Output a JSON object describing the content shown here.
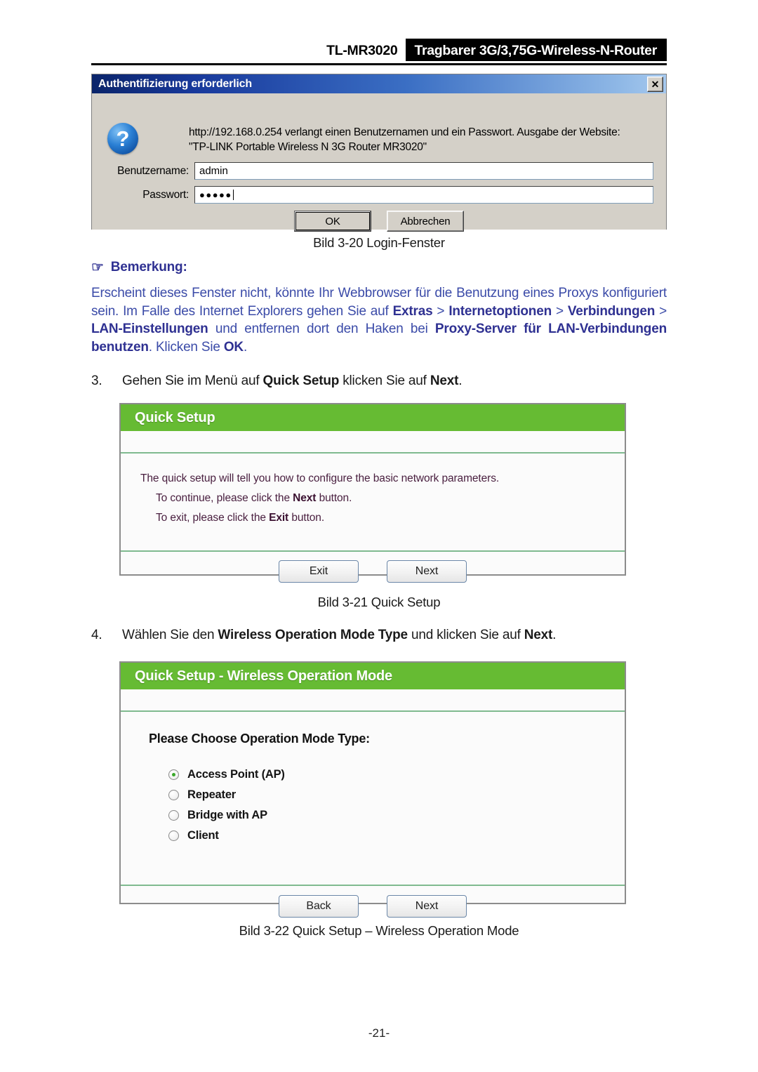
{
  "header": {
    "model": "TL-MR3020",
    "product": "Tragbarer 3G/3,75G-Wireless-N-Router"
  },
  "auth_dialog": {
    "title": "Authentifizierung erforderlich",
    "close_label": "✕",
    "icon": "question-icon",
    "icon_glyph": "?",
    "message_line1": "http://192.168.0.254 verlangt einen Benutzernamen und ein Passwort. Ausgabe der Website:",
    "message_line2": "\"TP-LINK Portable Wireless N 3G Router MR3020\"",
    "username_label": "Benutzername:",
    "username_value": "admin",
    "password_label": "Passwort:",
    "password_value": "●●●●●",
    "ok_label": "OK",
    "cancel_label": "Abbrechen"
  },
  "caption_320": "Bild 3-20 Login-Fenster",
  "note": {
    "hand_glyph": "☞",
    "heading": "Bemerkung:",
    "parts": [
      {
        "text": "Erscheint dieses Fenster nicht, könnte Ihr Webbrowser für die Benutzung eines Proxys konfiguriert sein. Im Falle des Internet Explorers gehen Sie auf ",
        "bold": false
      },
      {
        "text": "Extras",
        "bold": true
      },
      {
        "text": " > ",
        "bold": false
      },
      {
        "text": "Internetoptionen",
        "bold": true
      },
      {
        "text": " > ",
        "bold": false
      },
      {
        "text": "Verbindungen",
        "bold": true
      },
      {
        "text": " > ",
        "bold": false
      },
      {
        "text": "LAN-Einstellungen",
        "bold": true
      },
      {
        "text": " und entfernen dort den Haken bei ",
        "bold": false
      },
      {
        "text": "Proxy-Server für LAN-Verbindungen benutzen",
        "bold": true
      },
      {
        "text": ". Klicken Sie ",
        "bold": false
      },
      {
        "text": "OK",
        "bold": true
      },
      {
        "text": ".",
        "bold": false
      }
    ]
  },
  "step3": {
    "number": "3.",
    "parts": [
      {
        "text": "Gehen Sie im Menü auf ",
        "bold": false
      },
      {
        "text": "Quick Setup",
        "bold": true
      },
      {
        "text": " klicken Sie auf ",
        "bold": false
      },
      {
        "text": "Next",
        "bold": true
      },
      {
        "text": ".",
        "bold": false
      }
    ]
  },
  "quick_setup_panel": {
    "header": "Quick Setup",
    "lines": [
      {
        "parts": [
          {
            "text": "The quick setup will tell you how to configure the basic network parameters.",
            "bold": false
          }
        ],
        "indent": false
      },
      {
        "parts": [
          {
            "text": "To continue, please click the ",
            "bold": false
          },
          {
            "text": "Next",
            "bold": true
          },
          {
            "text": " button.",
            "bold": false
          }
        ],
        "indent": true
      },
      {
        "parts": [
          {
            "text": "To exit, please click the ",
            "bold": false
          },
          {
            "text": "Exit",
            "bold": true
          },
          {
            "text": "  button.",
            "bold": false
          }
        ],
        "indent": true
      }
    ],
    "buttons": [
      {
        "label": "Exit",
        "name": "exit-button"
      },
      {
        "label": "Next",
        "name": "next-button"
      }
    ]
  },
  "caption_321": "Bild 3-21 Quick Setup",
  "step4": {
    "number": "4.",
    "parts": [
      {
        "text": "Wählen Sie den ",
        "bold": false
      },
      {
        "text": "Wireless Operation Mode Type",
        "bold": true
      },
      {
        "text": " und klicken Sie auf ",
        "bold": false
      },
      {
        "text": "Next",
        "bold": true
      },
      {
        "text": ".",
        "bold": false
      }
    ]
  },
  "mode_panel": {
    "header": "Quick Setup - Wireless Operation Mode",
    "prompt": "Please Choose Operation Mode Type:",
    "options": [
      {
        "label": "Access Point (AP)",
        "selected": true
      },
      {
        "label": "Repeater",
        "selected": false
      },
      {
        "label": "Bridge with AP",
        "selected": false
      },
      {
        "label": "Client",
        "selected": false
      }
    ],
    "buttons": [
      {
        "label": "Back",
        "name": "back-button"
      },
      {
        "label": "Next",
        "name": "next-button"
      }
    ]
  },
  "caption_322": "Bild 3-22 Quick Setup – Wireless Operation Mode",
  "page_number": "-21-",
  "colors": {
    "panel_green": "#66bb33",
    "note_blue": "#3b4ba8",
    "note_bold_blue": "#2f3192",
    "radio_green": "#3aa82a",
    "titlebar_blue": "#0a246a"
  }
}
